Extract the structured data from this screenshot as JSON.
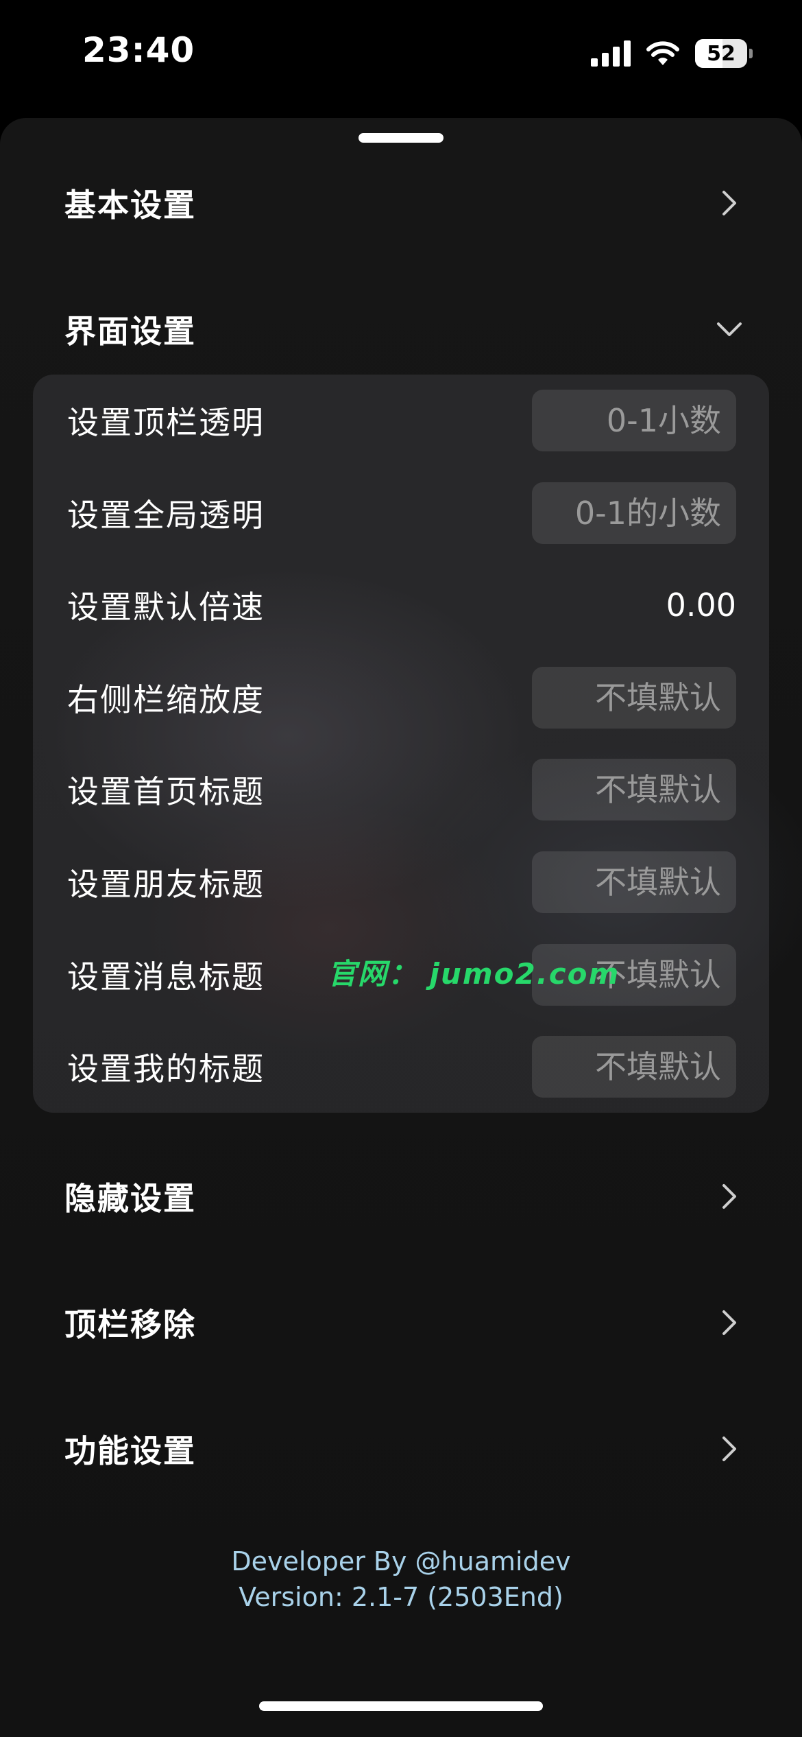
{
  "status_bar": {
    "time": "23:40",
    "battery_level": "52",
    "icons": [
      "cellular-signal-icon",
      "wifi-icon",
      "battery-icon"
    ]
  },
  "sections": {
    "basic": {
      "title": "基本设置",
      "state": "collapsed"
    },
    "interface": {
      "title": "界面设置",
      "state": "expanded"
    },
    "hidden": {
      "title": "隐藏设置",
      "state": "collapsed"
    },
    "topbar_remove": {
      "title": "顶栏移除",
      "state": "collapsed"
    },
    "features": {
      "title": "功能设置",
      "state": "collapsed"
    }
  },
  "interface_fields": [
    {
      "label": "设置顶栏透明",
      "value": "",
      "placeholder": "0-1小数"
    },
    {
      "label": "设置全局透明",
      "value": "",
      "placeholder": "0-1的小数"
    },
    {
      "label": "设置默认倍速",
      "value": "0.00",
      "placeholder": ""
    },
    {
      "label": "右侧栏缩放度",
      "value": "",
      "placeholder": "不填默认"
    },
    {
      "label": "设置首页标题",
      "value": "",
      "placeholder": "不填默认"
    },
    {
      "label": "设置朋友标题",
      "value": "",
      "placeholder": "不填默认"
    },
    {
      "label": "设置消息标题",
      "value": "",
      "placeholder": "不填默认"
    },
    {
      "label": "设置我的标题",
      "value": "",
      "placeholder": "不填默认"
    }
  ],
  "watermark": "官网： jumo2.com",
  "footer": {
    "developer": "Developer By @huamidev",
    "version": "Version: 2.1-7 (2503End)"
  },
  "colors": {
    "background": "#000000",
    "sheet": "#141414",
    "footer_text": "#a9d2ea",
    "watermark": "#27d86a"
  }
}
